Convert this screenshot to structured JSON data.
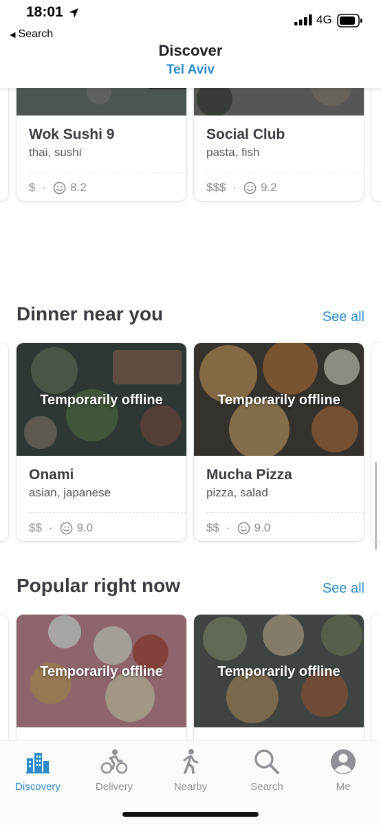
{
  "status": {
    "time": "18:01",
    "network": "4G",
    "back_label": "Search"
  },
  "header": {
    "title": "Discover",
    "subtitle": "Tel Aviv"
  },
  "offline_label": "Temporarily offline",
  "top_row": [
    {
      "name": "Wok Sushi 9",
      "categories": "thai, sushi",
      "price": "$",
      "rating": "8.2"
    },
    {
      "name": "Social Club",
      "categories": "pasta, fish",
      "price": "$$$",
      "rating": "9.2"
    }
  ],
  "dinner": {
    "title": "Dinner near you",
    "see_all": "See all",
    "cards": [
      {
        "name": "Onami",
        "categories": "asian, japanese",
        "price": "$$",
        "rating": "9.0"
      },
      {
        "name": "Mucha Pizza",
        "categories": "pizza, salad",
        "price": "$$",
        "rating": "9.0"
      }
    ]
  },
  "popular": {
    "title": "Popular right now",
    "see_all": "See all"
  },
  "tabs": [
    {
      "label": "Discovery",
      "icon": "discovery-icon",
      "active": true
    },
    {
      "label": "Delivery",
      "icon": "bicycle-icon",
      "active": false
    },
    {
      "label": "Nearby",
      "icon": "walking-icon",
      "active": false
    },
    {
      "label": "Search",
      "icon": "search-icon",
      "active": false
    },
    {
      "label": "Me",
      "icon": "profile-icon",
      "active": false
    }
  ],
  "colors": {
    "accent": "#2b8bc9",
    "text": "#202125",
    "muted": "#8a8b90"
  }
}
